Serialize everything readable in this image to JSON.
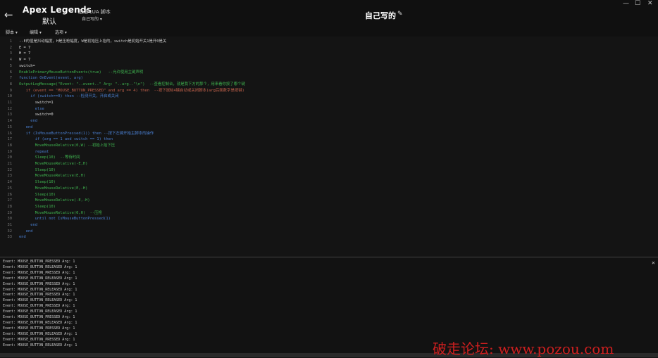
{
  "header": {
    "back_icon": "←",
    "game_title": "Apex Legends",
    "profile_name": "默认",
    "lua_label": "激活 LUA 脚本",
    "profile_dropdown": "自己写的 ▾",
    "script_title": "自己写的",
    "edit_icon": "✎",
    "minimize": "—",
    "maximize": "☐",
    "close": "✕"
  },
  "menu": {
    "script": "脚本 ▾",
    "edit": "编辑 ▾",
    "options": "选项 ▾"
  },
  "editor": {
    "lines": [
      {
        "n": "1",
        "t": "--E的值是抖动幅度，H是压枪幅度，W是初始压上抬的，switch是初始开关1是开0是关",
        "c": "#c8c8c8"
      },
      {
        "n": "2",
        "t": "E = 7",
        "c": "#d8d8d8"
      },
      {
        "n": "3",
        "t": "H = 7",
        "c": "#d8d8d8"
      },
      {
        "n": "4",
        "t": "W = 7",
        "c": "#d8d8d8"
      },
      {
        "n": "5",
        "t": "switch=",
        "c": "#d8d8d8"
      },
      {
        "n": "6",
        "t": "EnablePrimaryMouseButtonEvents(true)   --允许使用主键声明",
        "c": "#3fb34f"
      },
      {
        "n": "7",
        "t": "function OnEvent(event, arg)",
        "c": "#4a7fd0"
      },
      {
        "n": "8",
        "t": "OutputLogMessage(\"Event: \"..event..\" Arg: \"..arg..\"\\n\")  --查看控制台，就是我下方的那个，用来看你按了哪个键",
        "c": "#3fb34f"
      },
      {
        "n": "9",
        "t": "   if (event == \"MOUSE_BUTTON_PRESSED\" and arg == 4) then  --按下鼠标4键启动或关闭脚本(arg后面数字是按键)",
        "c": "#c0604a"
      },
      {
        "n": "10",
        "t": "     if (switch==0) then --检测开关，开启或关闭",
        "c": "#4a7fd0"
      },
      {
        "n": "11",
        "t": "       switch=1",
        "c": "#d8d8d8"
      },
      {
        "n": "12",
        "t": "       else",
        "c": "#4a7fd0"
      },
      {
        "n": "13",
        "t": "       switch=0",
        "c": "#d8d8d8"
      },
      {
        "n": "14",
        "t": "     end",
        "c": "#4a7fd0"
      },
      {
        "n": "15",
        "t": "   end",
        "c": "#4a7fd0"
      },
      {
        "n": "16",
        "t": "   if (IsMouseButtonPressed(1)) then --按下左键开始主脚本的操作",
        "c": "#4a7fd0"
      },
      {
        "n": "17",
        "t": "       if (arg == 1 and switch == 1) then",
        "c": "#4a7fd0"
      },
      {
        "n": "18",
        "t": "       MoveMouseRelative(0,W) --初始上抬下压",
        "c": "#3fb34f"
      },
      {
        "n": "19",
        "t": "       repeat",
        "c": "#4a7fd0"
      },
      {
        "n": "20",
        "t": "       Sleep(10)  --等待时间",
        "c": "#3fb34f"
      },
      {
        "n": "21",
        "t": "       MoveMouseRelative(-E,H)",
        "c": "#3fb34f"
      },
      {
        "n": "22",
        "t": "       Sleep(10)",
        "c": "#3fb34f"
      },
      {
        "n": "23",
        "t": "       MoveMouseRelative(E,H)",
        "c": "#3fb34f"
      },
      {
        "n": "24",
        "t": "       Sleep(10)",
        "c": "#3fb34f"
      },
      {
        "n": "25",
        "t": "       MoveMouseRelative(E,-H)",
        "c": "#3fb34f"
      },
      {
        "n": "26",
        "t": "       Sleep(10)",
        "c": "#3fb34f"
      },
      {
        "n": "27",
        "t": "       MoveMouseRelative(-E,-H)",
        "c": "#3fb34f"
      },
      {
        "n": "28",
        "t": "       Sleep(10)",
        "c": "#3fb34f"
      },
      {
        "n": "29",
        "t": "       MoveMouseRelative(0,H)  --压枪",
        "c": "#3fb34f"
      },
      {
        "n": "30",
        "t": "       until not IsMouseButtonPressed(1)",
        "c": "#4a7fd0"
      },
      {
        "n": "31",
        "t": "     end",
        "c": "#4a7fd0"
      },
      {
        "n": "32",
        "t": "   end",
        "c": "#4a7fd0"
      },
      {
        "n": "33",
        "t": "end",
        "c": "#4a7fd0"
      }
    ]
  },
  "console": {
    "close_icon": "✕",
    "lines": [
      "Event: MOUSE_BUTTON_PRESSED Arg: 1",
      "Event: MOUSE_BUTTON_RELEASED Arg: 1",
      "Event: MOUSE_BUTTON_PRESSED Arg: 1",
      "Event: MOUSE_BUTTON_RELEASED Arg: 1",
      "Event: MOUSE_BUTTON_PRESSED Arg: 1",
      "Event: MOUSE_BUTTON_RELEASED Arg: 1",
      "Event: MOUSE_BUTTON_PRESSED Arg: 1",
      "Event: MOUSE_BUTTON_RELEASED Arg: 1",
      "Event: MOUSE_BUTTON_PRESSED Arg: 1",
      "Event: MOUSE_BUTTON_RELEASED Arg: 1",
      "Event: MOUSE_BUTTON_PRESSED Arg: 1",
      "Event: MOUSE_BUTTON_RELEASED Arg: 1",
      "Event: MOUSE_BUTTON_PRESSED Arg: 1",
      "Event: MOUSE_BUTTON_RELEASED Arg: 1",
      "Event: MOUSE_BUTTON_PRESSED Arg: 1",
      "Event: MOUSE_BUTTON_RELEASED Arg: 1"
    ]
  },
  "watermark": "破走论坛: www.pozou.com"
}
